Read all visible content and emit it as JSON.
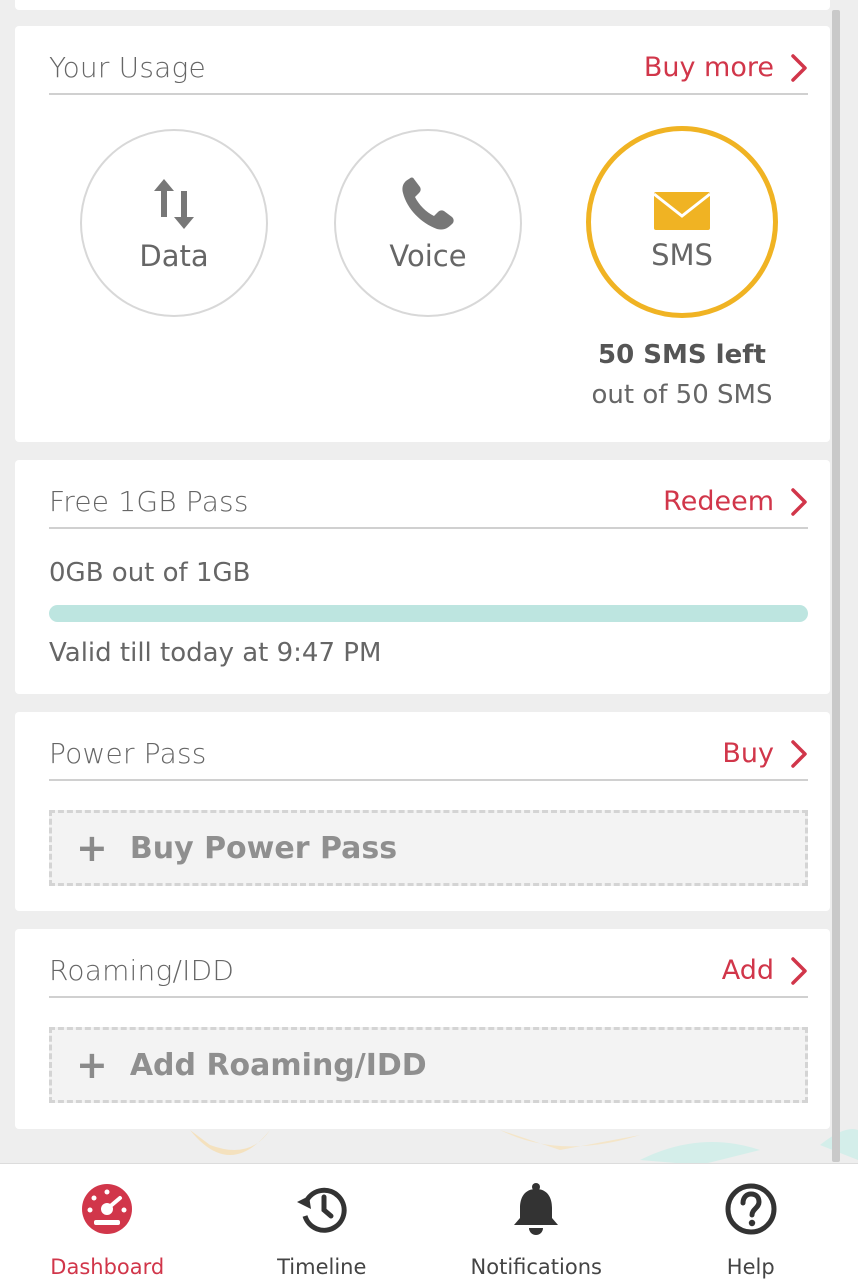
{
  "usage": {
    "title": "Your Usage",
    "action": "Buy more",
    "circles": [
      {
        "label": "Data",
        "icon": "data-arrows-icon",
        "active": false
      },
      {
        "label": "Voice",
        "icon": "phone-icon",
        "active": false
      },
      {
        "label": "SMS",
        "icon": "envelope-icon",
        "active": true
      }
    ],
    "sms_left": "50 SMS left",
    "sms_total": "out of 50 SMS"
  },
  "free_pass": {
    "title": "Free 1GB Pass",
    "action": "Redeem",
    "amount": "0GB out of 1GB",
    "progress_fraction": 0.0,
    "valid": "Valid till today at 9:47 PM"
  },
  "power_pass": {
    "title": "Power Pass",
    "action": "Buy",
    "add_label": "Buy Power Pass"
  },
  "roaming": {
    "title": "Roaming/IDD",
    "action": "Add",
    "add_label": "Add Roaming/IDD"
  },
  "nav": {
    "items": [
      {
        "label": "Dashboard",
        "icon": "dashboard-gauge-icon",
        "active": true
      },
      {
        "label": "Timeline",
        "icon": "timeline-history-icon",
        "active": false
      },
      {
        "label": "Notifications",
        "icon": "bell-icon",
        "active": false
      },
      {
        "label": "Help",
        "icon": "help-question-icon",
        "active": false
      }
    ]
  },
  "colors": {
    "accent_red": "#d1364a",
    "sms_ring": "#f0b323",
    "progress_track": "#bde5e0",
    "background": "#eeeeee"
  }
}
